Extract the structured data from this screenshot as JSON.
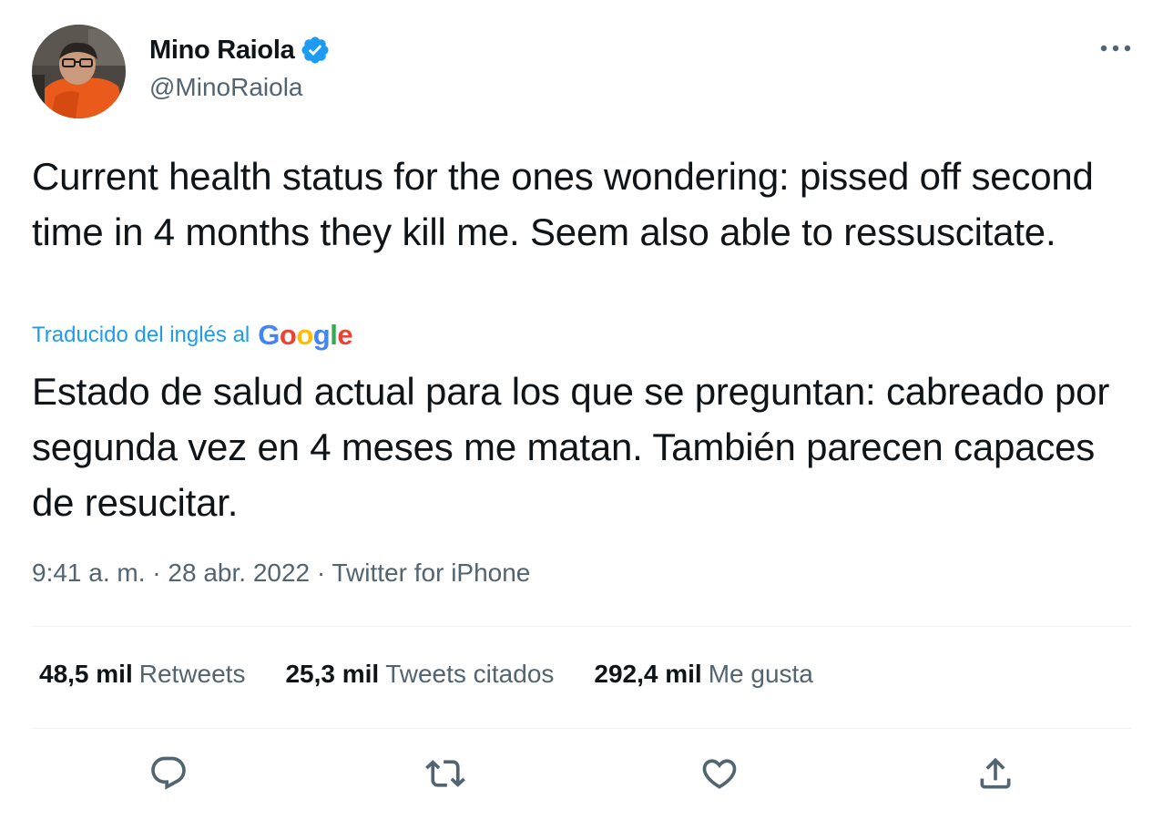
{
  "author": {
    "display_name": "Mino Raiola",
    "handle": "@MinoRaiola",
    "verified_icon": "verified-badge-icon"
  },
  "tweet": {
    "original_text": "Current health status for the ones wondering: pissed off second time in 4 months they kill me. Seem also able to ressuscitate.",
    "translation_label": "Traducido del inglés al",
    "translation_provider": "Google",
    "translated_text": "Estado de salud actual para los que se preguntan: cabreado por segunda vez en 4 meses me matan. También parecen capaces de resucitar.",
    "time": "9:41 a. m.",
    "separator": " · ",
    "date": "28 abr. 2022",
    "source": "Twitter for iPhone"
  },
  "stats": [
    {
      "value": "48,5 mil",
      "label": "Retweets"
    },
    {
      "value": "25,3 mil",
      "label": "Tweets citados"
    },
    {
      "value": "292,4 mil",
      "label": "Me gusta"
    }
  ],
  "actions": [
    "reply-icon",
    "retweet-icon",
    "like-icon",
    "share-icon"
  ],
  "colors": {
    "text_primary": "#0f1419",
    "text_secondary": "#536471",
    "accent": "#1d9bf0",
    "divider": "#eff3f4"
  }
}
